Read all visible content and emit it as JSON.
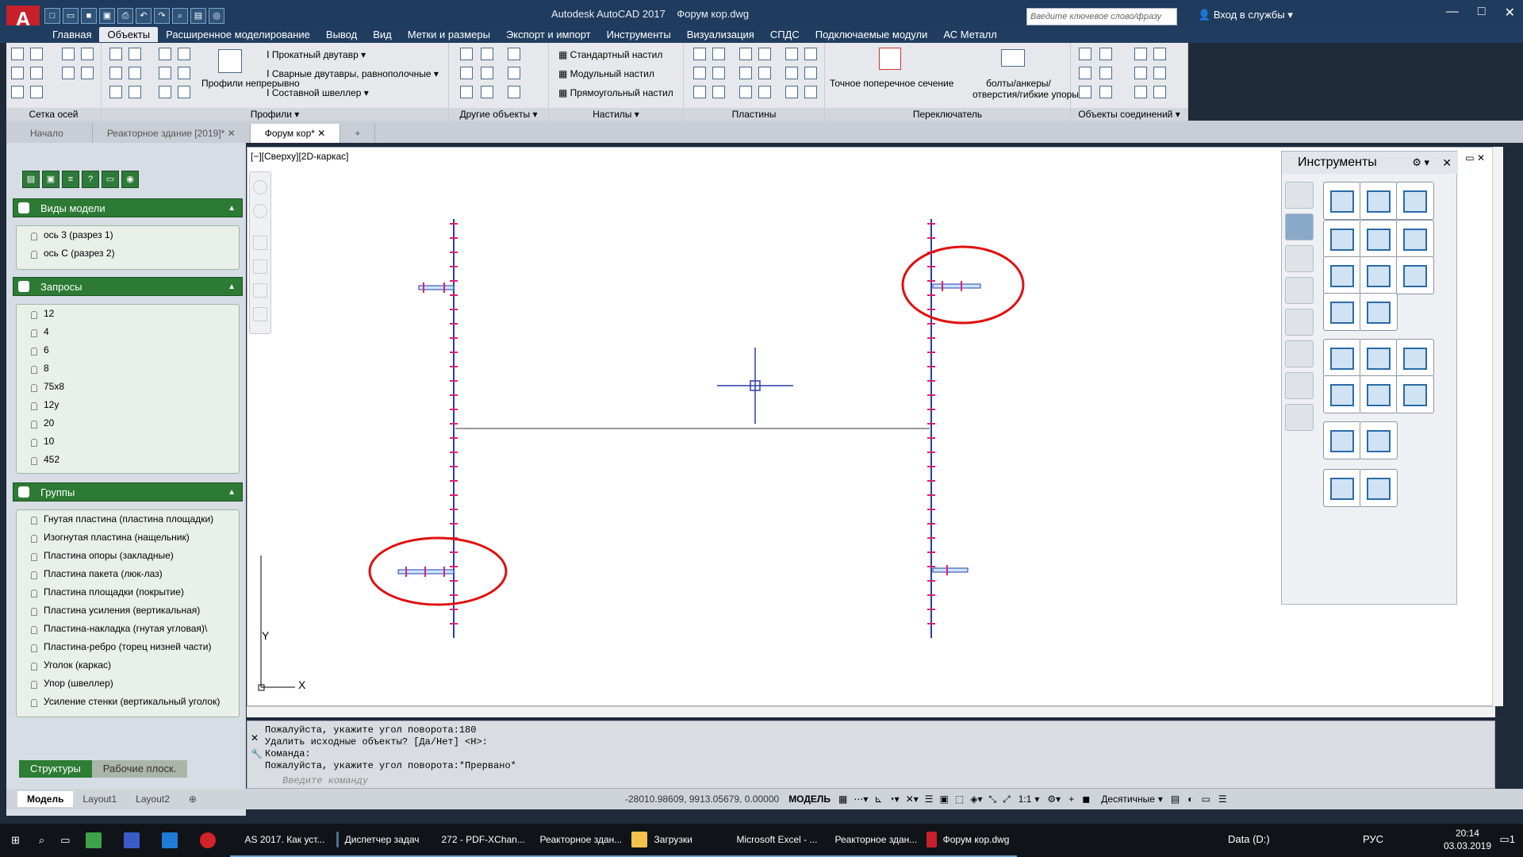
{
  "window": {
    "app_logo": "A",
    "title": "Autodesk AutoCAD 2017",
    "document": "Форум кор.dwg",
    "search_placeholder": "Введите ключевое слово/фразу",
    "sign_in": "Вход в службы",
    "minimize": "—",
    "maximize": "□",
    "close": "✕"
  },
  "menu": {
    "tabs": [
      "Главная",
      "Объекты",
      "Расширенное моделирование",
      "Вывод",
      "Вид",
      "Метки и размеры",
      "Экспорт и импорт",
      "Инструменты",
      "Визуализация",
      "СПДС",
      "Подключаемые модули",
      "АС Металл"
    ],
    "active_index": 1
  },
  "ribbon": {
    "groups": {
      "grid": "Сетка осей",
      "profiles": "Профили",
      "other": "Другие объекты",
      "decks": "Настилы",
      "plates": "Пластины",
      "switch": "Переключатель",
      "joints": "Объекты соединений"
    },
    "profiles_continuous": "Профили непрерывно",
    "rolled_ibeam": "Прокатный двутавр",
    "welded_ibeams": "Сварные двутавры, равнополочные",
    "composite_channel": "Составной швеллер",
    "standard_deck": "Стандартный настил",
    "modular_deck": "Модульный настил",
    "rect_deck": "Прямоугольный настил",
    "exact_section": "Точное поперечное сечение",
    "bolts": "болты/анкеры/",
    "bolts2": "отверстия/гибкие упоры"
  },
  "filetabs": {
    "start": "Начало",
    "reactor": "Реакторное здание [2019]*",
    "forum": "Форум кор*",
    "add": "+"
  },
  "panel": {
    "views_header": "Виды модели",
    "views": [
      "ось 3 (разрез 1)",
      "ось С (разрез 2)"
    ],
    "queries_header": "Запросы",
    "queries": [
      "12",
      "4",
      "6",
      "8",
      "75x8",
      "12y",
      "20",
      "10",
      "452"
    ],
    "groups_header": "Группы",
    "groups": [
      "Гнутая пластина (пластина площадки)",
      "Изогнутая пластина (нащельник)",
      "Пластина опоры (закладные)",
      "Пластина пакета (люк-лаз)",
      "Пластина площадки (покрытие)",
      "Пластина усиления (вертикальная)",
      "Пластина-накладка (гнутая угловая)\\",
      "Пластина-ребро (торец низней части)",
      "Уголок (каркас)",
      "Упор (швеллер)",
      "Усиление стенки (вертикальный уголок)"
    ],
    "tab_structures": "Структуры",
    "tab_workplanes": "Рабочие плоск."
  },
  "viewport": {
    "label": "[−][Сверху][2D-каркас]",
    "axis_y": "Y",
    "axis_x": "X"
  },
  "tool_palette": {
    "title": "Инструменты"
  },
  "command": {
    "history": [
      "Пожалуйста, укажите угол поворота:180",
      "Удалить исходные объекты? [Да/Нет] <Н>:",
      "Команда:",
      "Пожалуйста, укажите угол поворота:*Прервано*"
    ],
    "placeholder": "Введите команду"
  },
  "layouts": [
    "Модель",
    "Layout1",
    "Layout2"
  ],
  "status": {
    "coords": "-28010.98609, 9913.05679, 0.00000",
    "model": "МОДЕЛЬ",
    "scale": "1:1",
    "units": "Десятичные"
  },
  "taskbar": {
    "items": [
      "AS 2017. Как уст...",
      "Диспетчер задач",
      "272 - PDF-XChan...",
      "Реакторное здан...",
      "Загрузки",
      "Microsoft Excel - ...",
      "Реакторное здан...",
      "Форум кор.dwg"
    ],
    "drive": "Data (D:)",
    "lang": "РУС",
    "time": "20:14",
    "date": "03.03.2019",
    "notif": "1"
  }
}
